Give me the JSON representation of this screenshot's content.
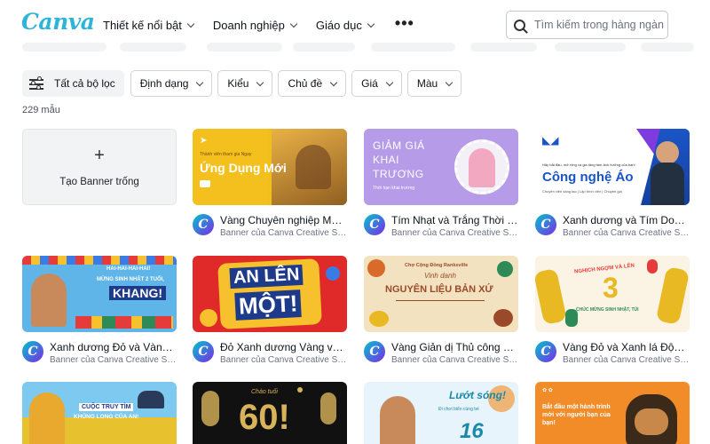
{
  "brand": {
    "logo_text": "Canva",
    "accent": "#2fb4d8"
  },
  "nav": {
    "items": [
      {
        "label": "Thiết kế nổi bật",
        "icon": "chevron-down-icon"
      },
      {
        "label": "Doanh nghiệp",
        "icon": "chevron-down-icon"
      },
      {
        "label": "Giáo dục",
        "icon": "chevron-down-icon"
      }
    ],
    "more_icon": "more-dots-icon"
  },
  "search": {
    "placeholder": "Tìm kiếm trong hàng ngàn mẫu",
    "icon": "search-icon"
  },
  "filters": {
    "all_label": "Tất cả bộ lọc",
    "buttons": [
      {
        "label": "Định dạng"
      },
      {
        "label": "Kiểu"
      },
      {
        "label": "Chủ đề"
      },
      {
        "label": "Giá"
      },
      {
        "label": "Màu"
      }
    ]
  },
  "result_count": "229 mẫu",
  "create_card": {
    "label": "Tạo Banner trống"
  },
  "templates": [
    {
      "title": "Vàng Chuyên nghiệp Màu...",
      "subtitle": "Banner của Canva Creative Stu...",
      "thumb": {
        "small": "Thành viên tham gia Ngay",
        "big": "Ứng Dụng Mới",
        "colors": [
          "#f4c01e",
          "#c98f20"
        ]
      }
    },
    {
      "title": "Tím Nhạt và Trắng Thời tr...",
      "subtitle": "Banner của Canva Creative Stu...",
      "thumb": {
        "line1": "GIẢM GIÁ",
        "line2": "KHAI",
        "line3": "TRƯƠNG",
        "small": "Thời hạn khai trương",
        "colors": [
          "#b59be8",
          "#f2a8c0"
        ]
      }
    },
    {
      "title": "Xanh dương và Tím Doan...",
      "subtitle": "Banner của Canva Creative Stu...",
      "thumb": {
        "small": "Hãy bắt đầu, mở rộng và gia tăng tầm ảnh hưởng của bạn!",
        "big": "Công nghệ Áo",
        "foot": "Chuyên viên sáng tạo | Lập trình viên | Chuyên gia",
        "colors": [
          "#1a55c7",
          "#7d3be0"
        ]
      }
    },
    {
      "title": "Xanh dương Đỏ và Vàng ...",
      "subtitle": "Banner của Canva Creative Stu...",
      "thumb": {
        "line1": "HAI-HAI-HAI-HAI!",
        "line2": "MỪNG SINH NHẬT 2 TUỔI,",
        "big": "KHANG!",
        "colors": [
          "#5fb5e8",
          "#e63b3b"
        ]
      }
    },
    {
      "title": "Đỏ Xanh dương Vàng và T...",
      "subtitle": "Banner của Canva Creative Stu...",
      "thumb": {
        "line1": "AN LÊN",
        "line2": "MỘT!",
        "colors": [
          "#e02a2a",
          "#f6c12c"
        ]
      }
    },
    {
      "title": "Vàng Giản dị Thủ công Sự...",
      "subtitle": "Banner của Canva Creative Stu...",
      "thumb": {
        "small": "Chợ Cộng Đồng Ranksville",
        "line1": "Vinh danh",
        "big": "NGUYÊN LIỆU BẢN XỨ",
        "colors": [
          "#f3e2bf",
          "#9a4a2a"
        ]
      }
    },
    {
      "title": "Vàng Đỏ và Xanh lá Động ...",
      "subtitle": "Banner của Canva Creative Stu...",
      "thumb": {
        "line1": "NGHỊCH NGỢM VÀ LÊN",
        "big": "3",
        "line2": "CHÚC MỪNG SINH NHẬT, TÚI",
        "colors": [
          "#fbf3e4",
          "#e8b923"
        ]
      }
    },
    {
      "title": "",
      "subtitle": "",
      "thumb": {
        "line1": "CUỘC TRUY TÌM",
        "line2": "KHỦNG LONG CỦA AN!",
        "colors": [
          "#7ec9f0",
          "#e8c22e"
        ]
      }
    },
    {
      "title": "",
      "subtitle": "",
      "thumb": {
        "line1": "Chào tuổi",
        "big": "60!",
        "colors": [
          "#111111",
          "#d9b35a"
        ]
      }
    },
    {
      "title": "",
      "subtitle": "",
      "thumb": {
        "line1": "Lướt sóng!",
        "line2": "Đi chơi biển cùng bé",
        "big": "16",
        "colors": [
          "#e8f4fb",
          "#f29a3a"
        ]
      }
    },
    {
      "title": "",
      "subtitle": "",
      "thumb": {
        "small": "Bắt đầu một hành trình mới với người bạn của bạn!",
        "colors": [
          "#f28c28",
          "#3b2a1a"
        ]
      }
    }
  ],
  "creator_avatar_letter": "C"
}
